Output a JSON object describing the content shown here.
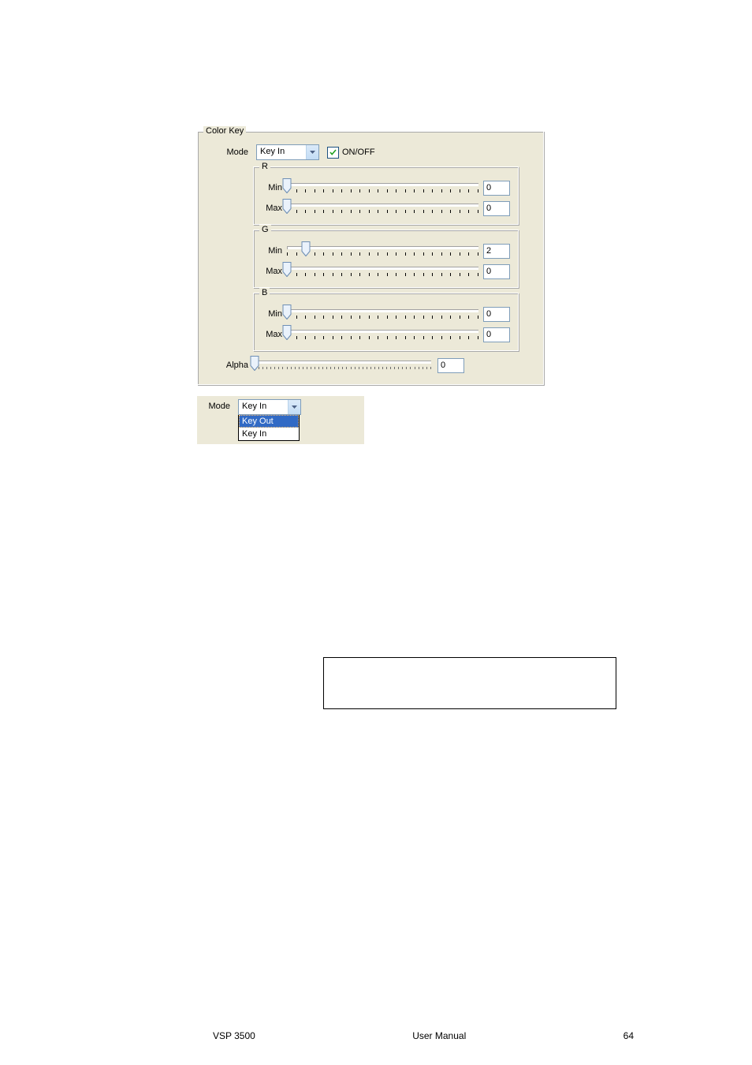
{
  "colorKey": {
    "legend": "Color Key",
    "modeLabel": "Mode",
    "modeValue": "Key In",
    "onoffLabel": "ON/OFF",
    "onoffChecked": true,
    "channels": [
      {
        "legend": "R",
        "min": {
          "label": "Min",
          "value": "0",
          "pos": 0
        },
        "max": {
          "label": "Max",
          "value": "0",
          "pos": 0
        }
      },
      {
        "legend": "G",
        "min": {
          "label": "Min",
          "value": "2",
          "pos": 10
        },
        "max": {
          "label": "Max",
          "value": "0",
          "pos": 0
        }
      },
      {
        "legend": "B",
        "min": {
          "label": "Min",
          "value": "0",
          "pos": 0
        },
        "max": {
          "label": "Max",
          "value": "0",
          "pos": 0
        }
      }
    ],
    "alphaLabel": "Alpha",
    "alpha": {
      "value": "0",
      "pos": 0
    }
  },
  "modeDropdown": {
    "label": "Mode",
    "value": "Key In",
    "options": [
      {
        "label": "Key Out",
        "selected": true
      },
      {
        "label": "Key In",
        "selected": false
      }
    ]
  },
  "footer": {
    "left": "VSP 3500",
    "center": "User Manual",
    "right": "64"
  }
}
